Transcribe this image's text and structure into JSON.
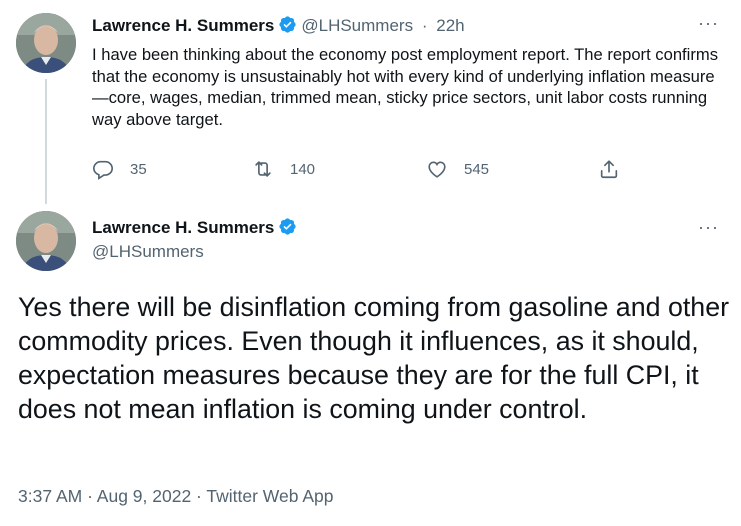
{
  "thread_tweet": {
    "author_name": "Lawrence H. Summers",
    "handle": "@LHSummers",
    "separator": "·",
    "time_ago": "22h",
    "more": "···",
    "text": "I have been thinking about the economy post  employment report. The report confirms that the economy is unsustainably hot with every kind of underlying inflation measure—core, wages, median, trimmed mean, sticky price sectors, unit labor costs running way above target.",
    "actions": {
      "replies": "35",
      "retweets": "140",
      "likes": "545"
    },
    "icons": [
      "reply-icon",
      "retweet-icon",
      "like-icon",
      "share-icon"
    ]
  },
  "main_tweet": {
    "author_name": "Lawrence H. Summers",
    "handle": "@LHSummers",
    "more": "···",
    "text": "Yes there will be disinflation coming from gasoline and other commodity prices. Even though it influences, as it should, expectation measures because they are for the full CPI, it does not mean inflation is coming under control.",
    "meta": "3:37 AM · Aug 9, 2022 · Twitter Web App"
  },
  "colors": {
    "text": "#0f1419",
    "secondary": "#536471",
    "verified": "#1d9bf0",
    "thread_line": "#cfd9de"
  }
}
